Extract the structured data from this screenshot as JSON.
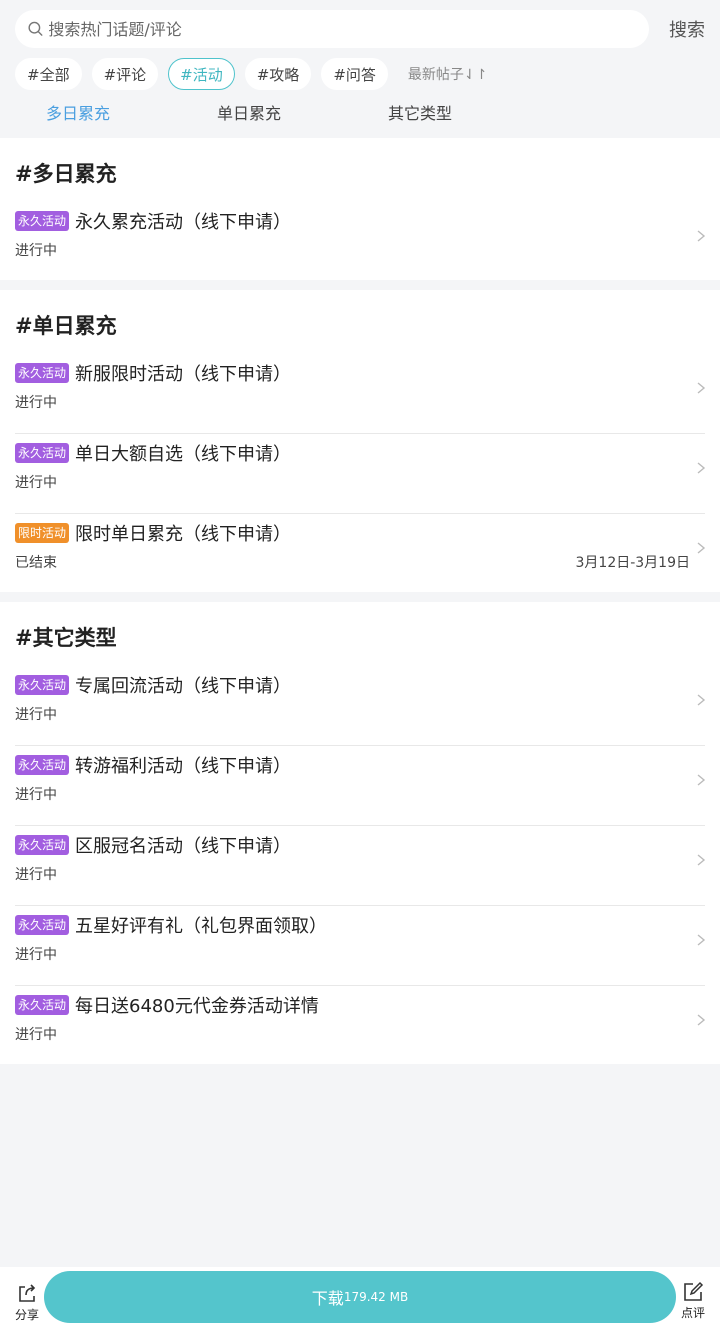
{
  "search": {
    "placeholder": "搜索热门话题/评论",
    "button": "搜索"
  },
  "tags": [
    {
      "label": "#全部"
    },
    {
      "label": "#评论"
    },
    {
      "label": "#活动",
      "active": true
    },
    {
      "label": "#攻略"
    },
    {
      "label": "#问答"
    }
  ],
  "sort_label": "最新帖子⇃↾",
  "subtabs": [
    "多日累充",
    "单日累充",
    "其它类型"
  ],
  "sections": [
    {
      "title": "#多日累充",
      "items": [
        {
          "badge": "永久活动",
          "title": "永久累充活动（线下申请）",
          "status": "进行中"
        }
      ]
    },
    {
      "title": "#单日累充",
      "items": [
        {
          "badge": "永久活动",
          "title": "新服限时活动（线下申请）",
          "status": "进行中"
        },
        {
          "badge": "永久活动",
          "title": "单日大额自选（线下申请）",
          "status": "进行中"
        },
        {
          "badge": "限时活动",
          "title": "限时单日累充（线下申请）",
          "status": "已结束",
          "date": "3月12日-3月19日"
        }
      ]
    },
    {
      "title": "#其它类型",
      "items": [
        {
          "badge": "永久活动",
          "title": "专属回流活动（线下申请）",
          "status": "进行中"
        },
        {
          "badge": "永久活动",
          "title": "转游福利活动（线下申请）",
          "status": "进行中"
        },
        {
          "badge": "永久活动",
          "title": "区服冠名活动（线下申请）",
          "status": "进行中"
        },
        {
          "badge": "永久活动",
          "title": "五星好评有礼（礼包界面领取）",
          "status": "进行中"
        },
        {
          "badge": "永久活动",
          "title": "每日送6480元代金券活动详情",
          "status": "进行中"
        }
      ]
    }
  ],
  "bottom": {
    "share": "分享",
    "download": "下载",
    "size": "179.42 MB",
    "review": "点评"
  },
  "colors": {
    "accent": "#54c5cc",
    "permanent_badge": "#a25ee0",
    "limited_badge": "#f0902a",
    "active_subtab": "#4a9fe0"
  },
  "icons": {
    "search": "search-icon",
    "share": "share-icon",
    "review": "edit-icon",
    "chevron": "chevron-right-icon"
  }
}
